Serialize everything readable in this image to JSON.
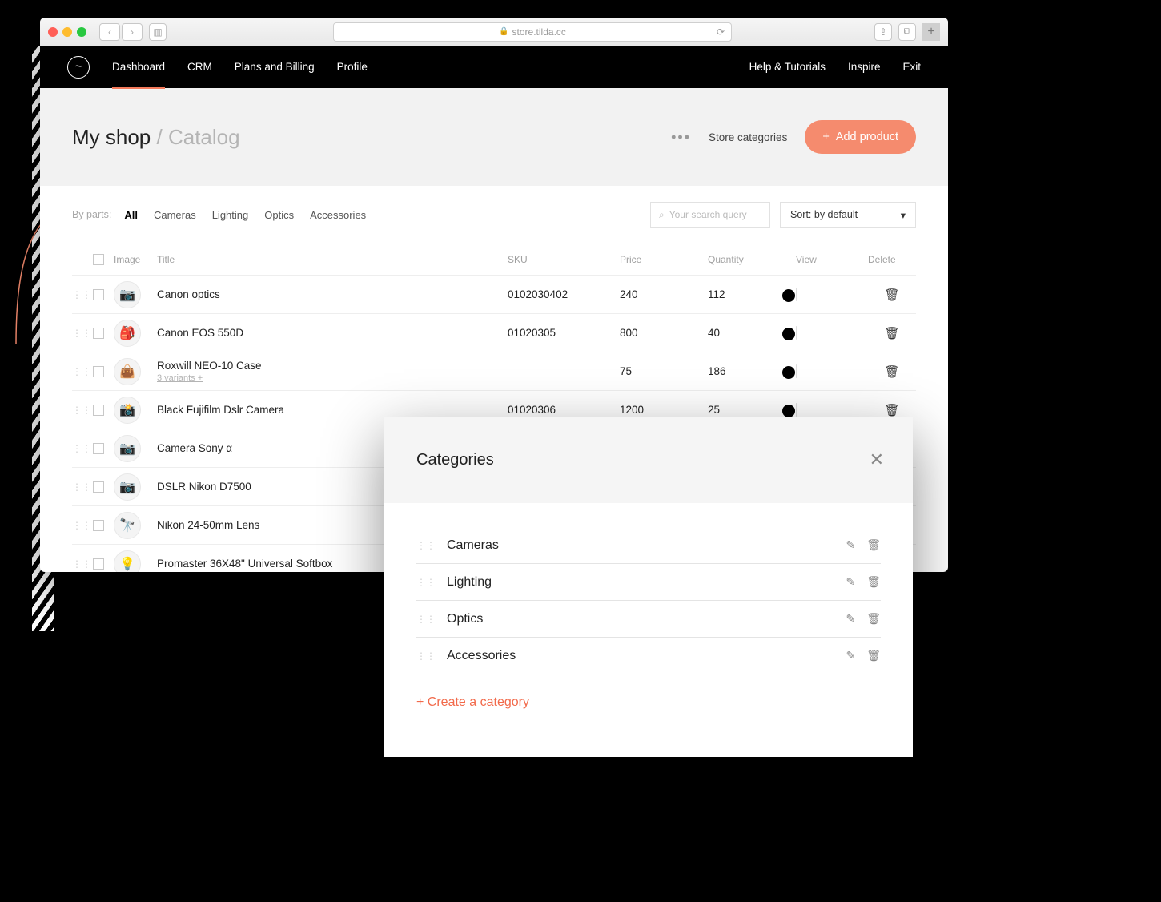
{
  "browser": {
    "address": "store.tilda.cc"
  },
  "nav": {
    "items": [
      "Dashboard",
      "CRM",
      "Plans and Billing",
      "Profile"
    ],
    "right": [
      "Help & Tutorials",
      "Inspire",
      "Exit"
    ],
    "active": "Dashboard"
  },
  "header": {
    "shop_name": "My shop",
    "section": "Catalog",
    "store_categories": "Store categories",
    "add_product": "Add product"
  },
  "filters": {
    "label": "By parts:",
    "chips": [
      "All",
      "Cameras",
      "Lighting",
      "Optics",
      "Accessories"
    ],
    "active": "All",
    "search_placeholder": "Your search query",
    "sort_label": "Sort: by default"
  },
  "table": {
    "columns": {
      "image": "Image",
      "title": "Title",
      "sku": "SKU",
      "price": "Price",
      "qty": "Quantity",
      "view": "View",
      "delete": "Delete"
    },
    "rows": [
      {
        "thumb": "📷",
        "title": "Canon optics",
        "variants": "",
        "sku": "0102030402",
        "price": "240",
        "qty": "112"
      },
      {
        "thumb": "🎒",
        "title": "Canon EOS 550D",
        "variants": "",
        "sku": "01020305",
        "price": "800",
        "qty": "40"
      },
      {
        "thumb": "👜",
        "title": "Roxwill NEO-10 Case",
        "variants": "3 variants +",
        "sku": "",
        "price": "75",
        "qty": "186"
      },
      {
        "thumb": "📸",
        "title": "Black Fujifilm Dslr Camera",
        "variants": "",
        "sku": "01020306",
        "price": "1200",
        "qty": "25"
      },
      {
        "thumb": "📷",
        "title": "Camera Sony α",
        "variants": "",
        "sku": "",
        "price": "",
        "qty": ""
      },
      {
        "thumb": "📷",
        "title": "DSLR Nikon D7500",
        "variants": "",
        "sku": "",
        "price": "",
        "qty": ""
      },
      {
        "thumb": "🔭",
        "title": "Nikon 24-50mm Lens",
        "variants": "",
        "sku": "",
        "price": "",
        "qty": ""
      },
      {
        "thumb": "💡",
        "title": "Promaster 36X48\" Universal Softbox",
        "variants": "",
        "sku": "",
        "price": "",
        "qty": ""
      }
    ]
  },
  "popover": {
    "title": "Categories",
    "items": [
      "Cameras",
      "Lighting",
      "Optics",
      "Accessories"
    ],
    "create_label": "+ Create a category"
  }
}
